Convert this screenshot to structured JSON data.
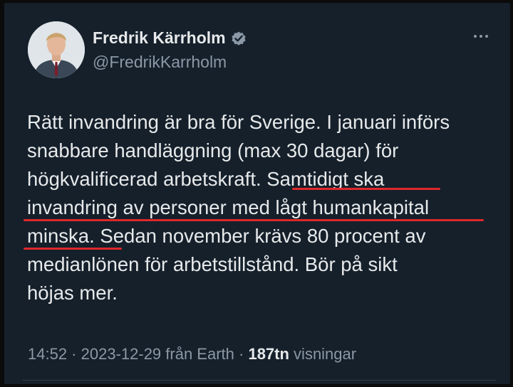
{
  "author": {
    "name": "Fredrik Kärrholm",
    "handle": "@FredrikKarrholm",
    "verified_icon": "verified-badge-icon",
    "badge_color": "#8b98a5"
  },
  "tweet": {
    "lines": [
      "Rätt invandring är bra för Sverige. I januari införs",
      "snabbare handläggning (max 30 dagar) för",
      "högkvalificerad arbetskraft. Samtidigt ska",
      "invandring av personer med lågt humankapital",
      "minska. Sedan november krävs 80 procent av",
      "medianlönen för arbetstillstånd. Bör på sikt",
      "höjas mer."
    ],
    "highlight_color": "#e0282a"
  },
  "meta": {
    "time": "14:52",
    "sep1": " · ",
    "date": "2023-12-29",
    "source": " från Earth",
    "sep2": " · ",
    "views": "187tn",
    "views_label": " visningar"
  }
}
